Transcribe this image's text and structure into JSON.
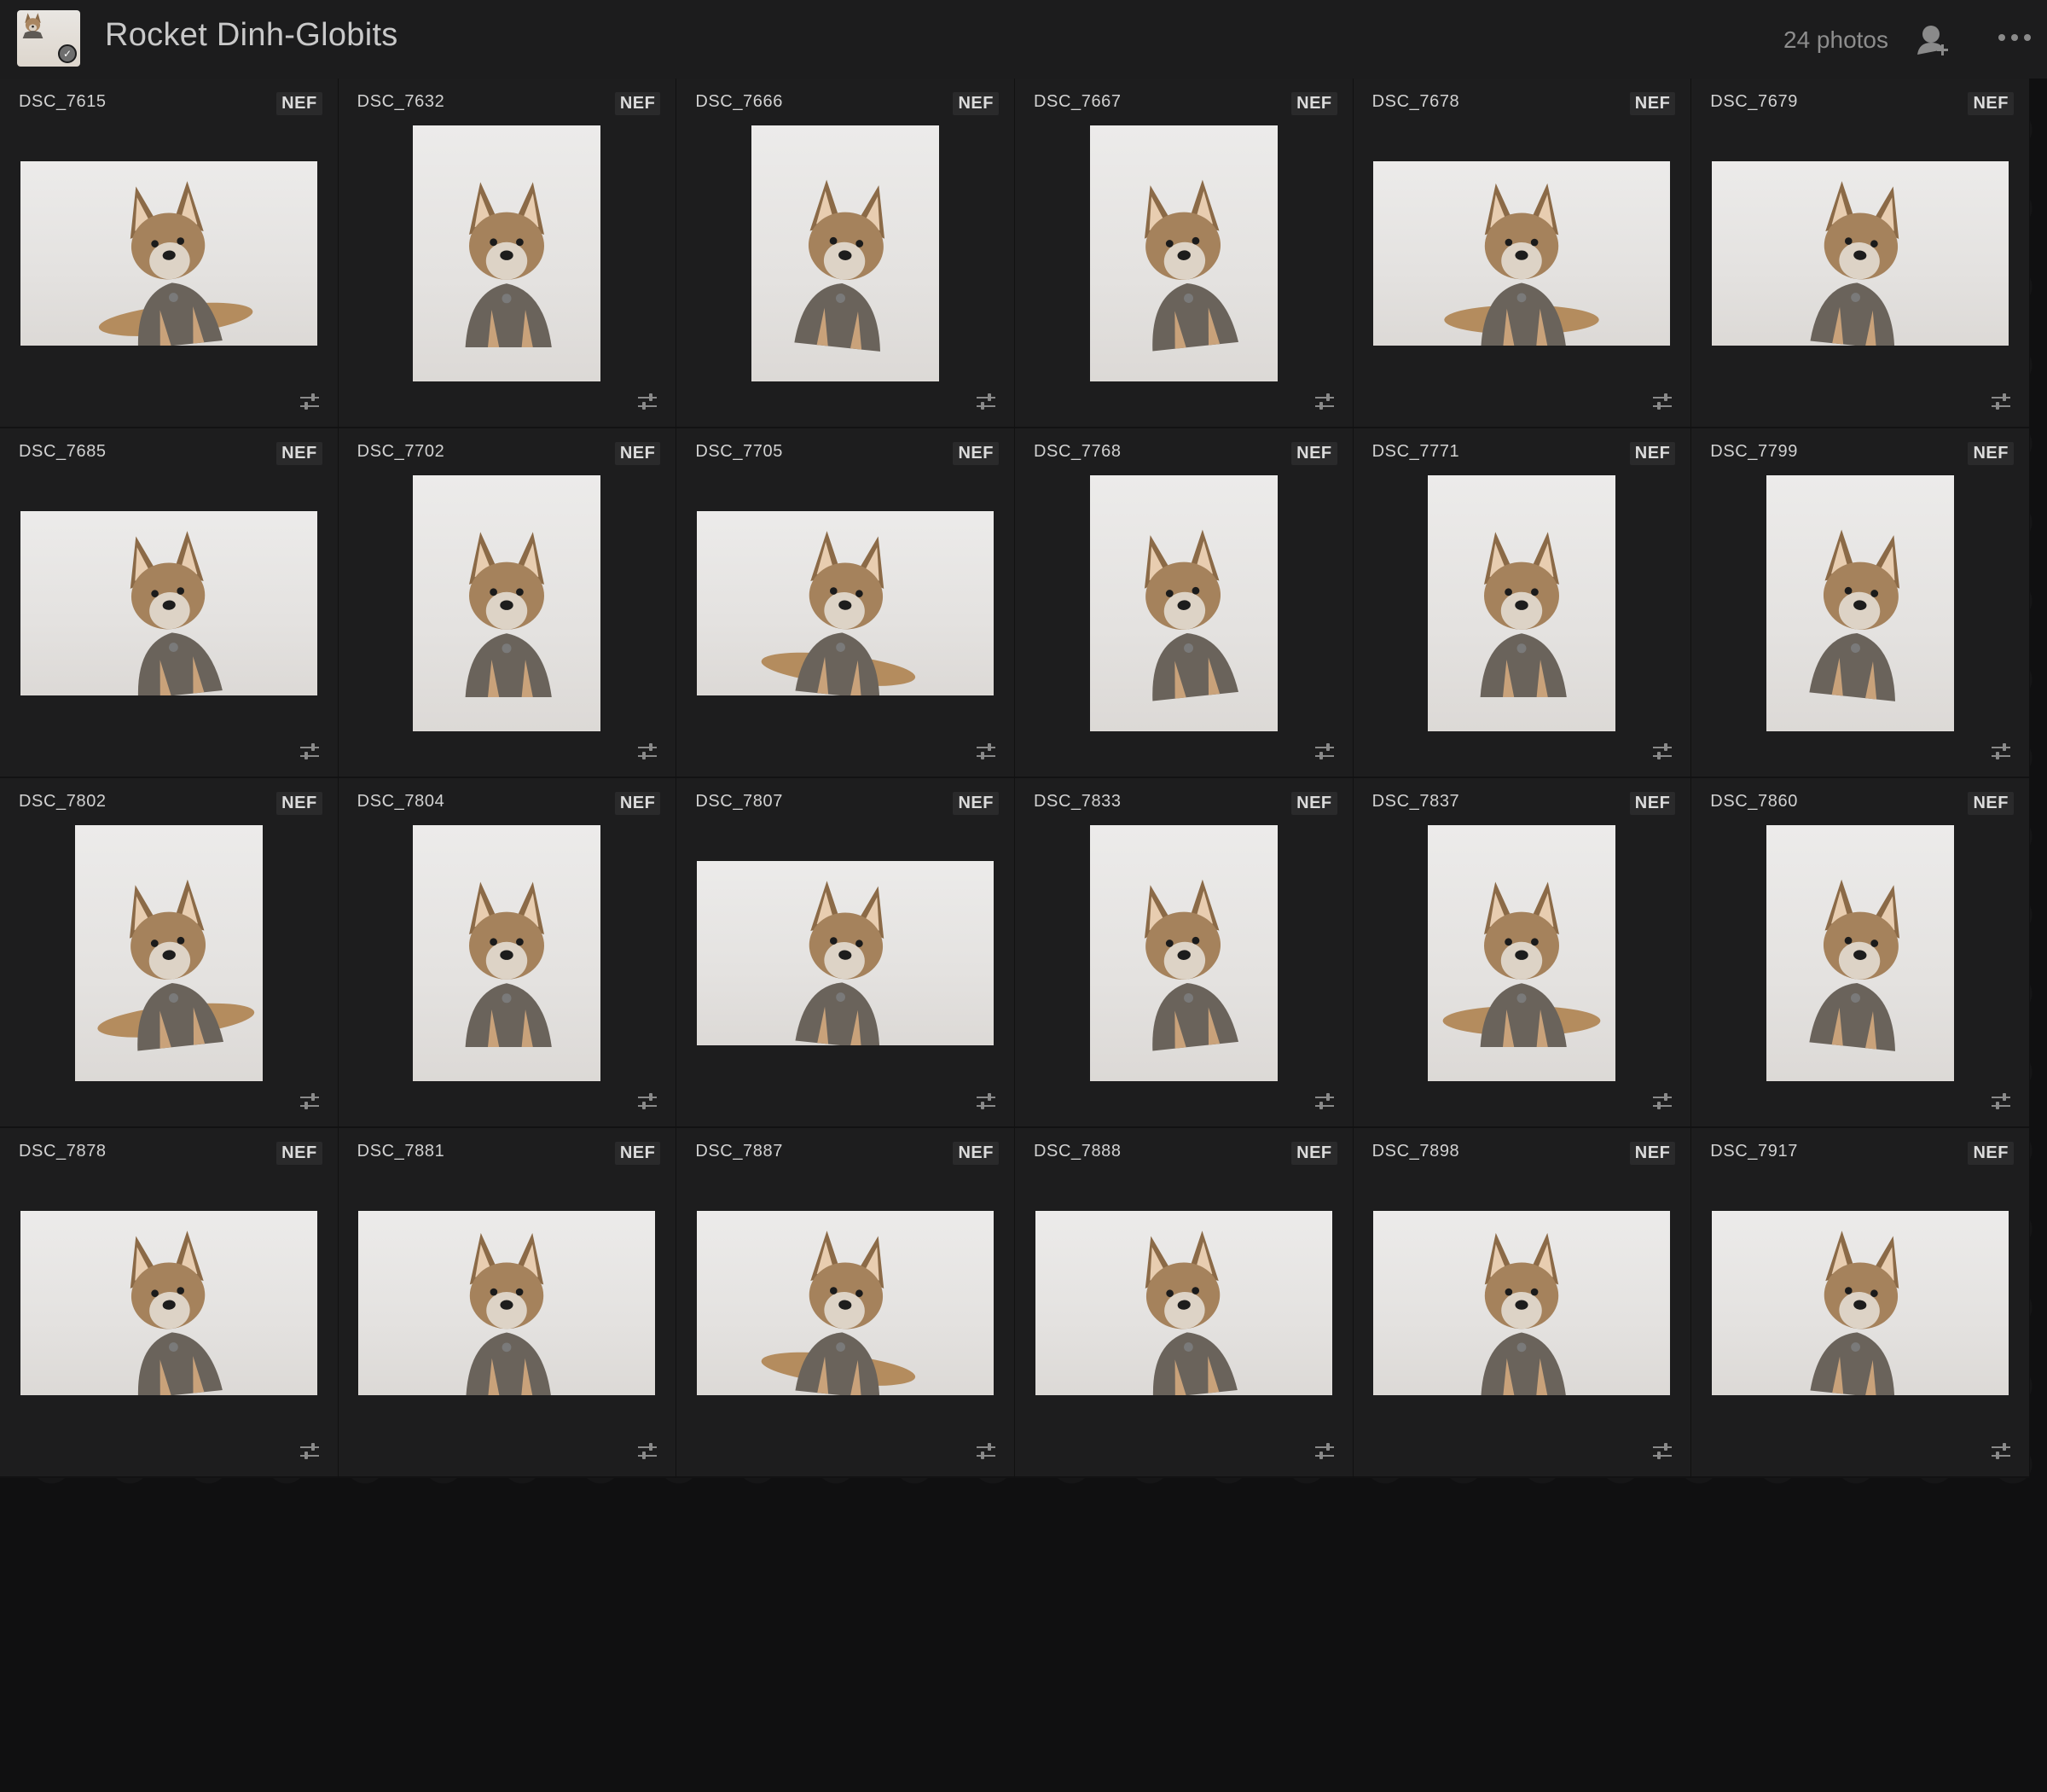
{
  "header": {
    "album_title": "Rocket Dinh-Globits",
    "photo_count": "24 photos",
    "icons": {
      "album_thumbnail": "album-cover-thumbnail",
      "sync_check": "checkmark-icon",
      "share": "add-person-icon",
      "more": "more-options-icon"
    }
  },
  "colors": {
    "background": "#101011",
    "cell_background": "#1d1d1e",
    "text": "#d2d2d2",
    "muted_text": "#8d8d8d"
  },
  "grid": {
    "badge_icon": "adjust-sliders-icon",
    "photos": [
      {
        "name": "DSC_7615",
        "format": "NEF",
        "orientation": "landscape"
      },
      {
        "name": "DSC_7632",
        "format": "NEF",
        "orientation": "portrait"
      },
      {
        "name": "DSC_7666",
        "format": "NEF",
        "orientation": "portrait"
      },
      {
        "name": "DSC_7667",
        "format": "NEF",
        "orientation": "portrait"
      },
      {
        "name": "DSC_7678",
        "format": "NEF",
        "orientation": "landscape"
      },
      {
        "name": "DSC_7679",
        "format": "NEF",
        "orientation": "landscape"
      },
      {
        "name": "DSC_7685",
        "format": "NEF",
        "orientation": "landscape"
      },
      {
        "name": "DSC_7702",
        "format": "NEF",
        "orientation": "portrait"
      },
      {
        "name": "DSC_7705",
        "format": "NEF",
        "orientation": "landscape"
      },
      {
        "name": "DSC_7768",
        "format": "NEF",
        "orientation": "portrait"
      },
      {
        "name": "DSC_7771",
        "format": "NEF",
        "orientation": "portrait"
      },
      {
        "name": "DSC_7799",
        "format": "NEF",
        "orientation": "portrait"
      },
      {
        "name": "DSC_7802",
        "format": "NEF",
        "orientation": "portrait"
      },
      {
        "name": "DSC_7804",
        "format": "NEF",
        "orientation": "portrait"
      },
      {
        "name": "DSC_7807",
        "format": "NEF",
        "orientation": "landscape"
      },
      {
        "name": "DSC_7833",
        "format": "NEF",
        "orientation": "portrait"
      },
      {
        "name": "DSC_7837",
        "format": "NEF",
        "orientation": "portrait"
      },
      {
        "name": "DSC_7860",
        "format": "NEF",
        "orientation": "portrait"
      },
      {
        "name": "DSC_7878",
        "format": "NEF",
        "orientation": "landscape"
      },
      {
        "name": "DSC_7881",
        "format": "NEF",
        "orientation": "landscape"
      },
      {
        "name": "DSC_7887",
        "format": "NEF",
        "orientation": "landscape"
      },
      {
        "name": "DSC_7888",
        "format": "NEF",
        "orientation": "landscape"
      },
      {
        "name": "DSC_7898",
        "format": "NEF",
        "orientation": "landscape"
      },
      {
        "name": "DSC_7917",
        "format": "NEF",
        "orientation": "landscape"
      }
    ]
  }
}
